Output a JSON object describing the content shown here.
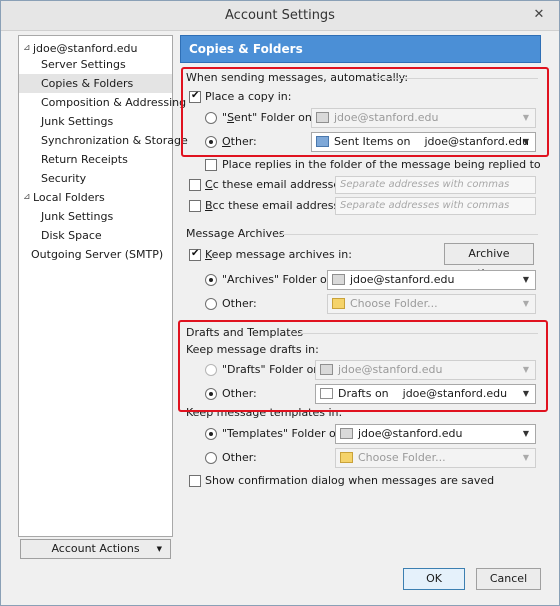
{
  "window": {
    "title": "Account Settings",
    "close_glyph": "✕"
  },
  "tree": {
    "items": [
      {
        "label": "jdoe@stanford.edu",
        "toggle": "⊿"
      },
      {
        "label": "Server Settings"
      },
      {
        "label": "Copies & Folders"
      },
      {
        "label": "Composition & Addressing"
      },
      {
        "label": "Junk Settings"
      },
      {
        "label": "Synchronization & Storage"
      },
      {
        "label": "Return Receipts"
      },
      {
        "label": "Security"
      },
      {
        "label": "Local Folders",
        "toggle": "⊿"
      },
      {
        "label": "Junk Settings"
      },
      {
        "label": "Disk Space"
      },
      {
        "label": "Outgoing Server (SMTP)"
      }
    ]
  },
  "account_actions": {
    "label": "Account Actions",
    "arrow": "▼"
  },
  "panel": {
    "header": "Copies & Folders",
    "sending": {
      "title": "When sending messages, automatically:",
      "place_copy": "Place a copy in:",
      "sent_folder_on_prefix": "\"",
      "sent_folder_on_key": "S",
      "sent_folder_on_rest": "ent\" Folder on:",
      "sent_account": "jdoe@stanford.edu",
      "other_key": "O",
      "other_rest": "ther:",
      "other_value": "Sent Items on    jdoe@stanford.edu",
      "place_replies": "Place replies in the folder of the message being replied to",
      "cc_key": "C",
      "cc_rest": "c these email addresses:",
      "bcc_key": "B",
      "bcc_rest": "cc these email addresses:",
      "addr_placeholder": "Separate addresses with commas"
    },
    "archives": {
      "title": "Message Archives",
      "keep_key": "K",
      "keep_rest": "eep message archives in:",
      "options_button": "Archive options...",
      "archives_folder_on": "\"Archives\" Folder on:",
      "archives_account": "jdoe@stanford.edu",
      "other": "Other:",
      "choose_folder": "Choose Folder..."
    },
    "drafts": {
      "title": "Drafts and Templates",
      "keep_drafts": "Keep message drafts in:",
      "drafts_folder_on": "\"Drafts\" Folder on:",
      "drafts_account": "jdoe@stanford.edu",
      "other": "Other:",
      "other_value": "Drafts on    jdoe@stanford.edu",
      "keep_templates": "Keep message templates in:",
      "templates_folder_on": "\"Templates\" Folder on:",
      "templates_account": "jdoe@stanford.edu",
      "templates_other": "Other:",
      "choose_folder": "Choose Folder...",
      "show_confirmation": "Show confirmation dialog when messages are saved"
    }
  },
  "buttons": {
    "ok": "OK",
    "cancel": "Cancel"
  },
  "colors": {
    "header_bg": "#4b8fd6",
    "highlight": "#e0121f"
  }
}
